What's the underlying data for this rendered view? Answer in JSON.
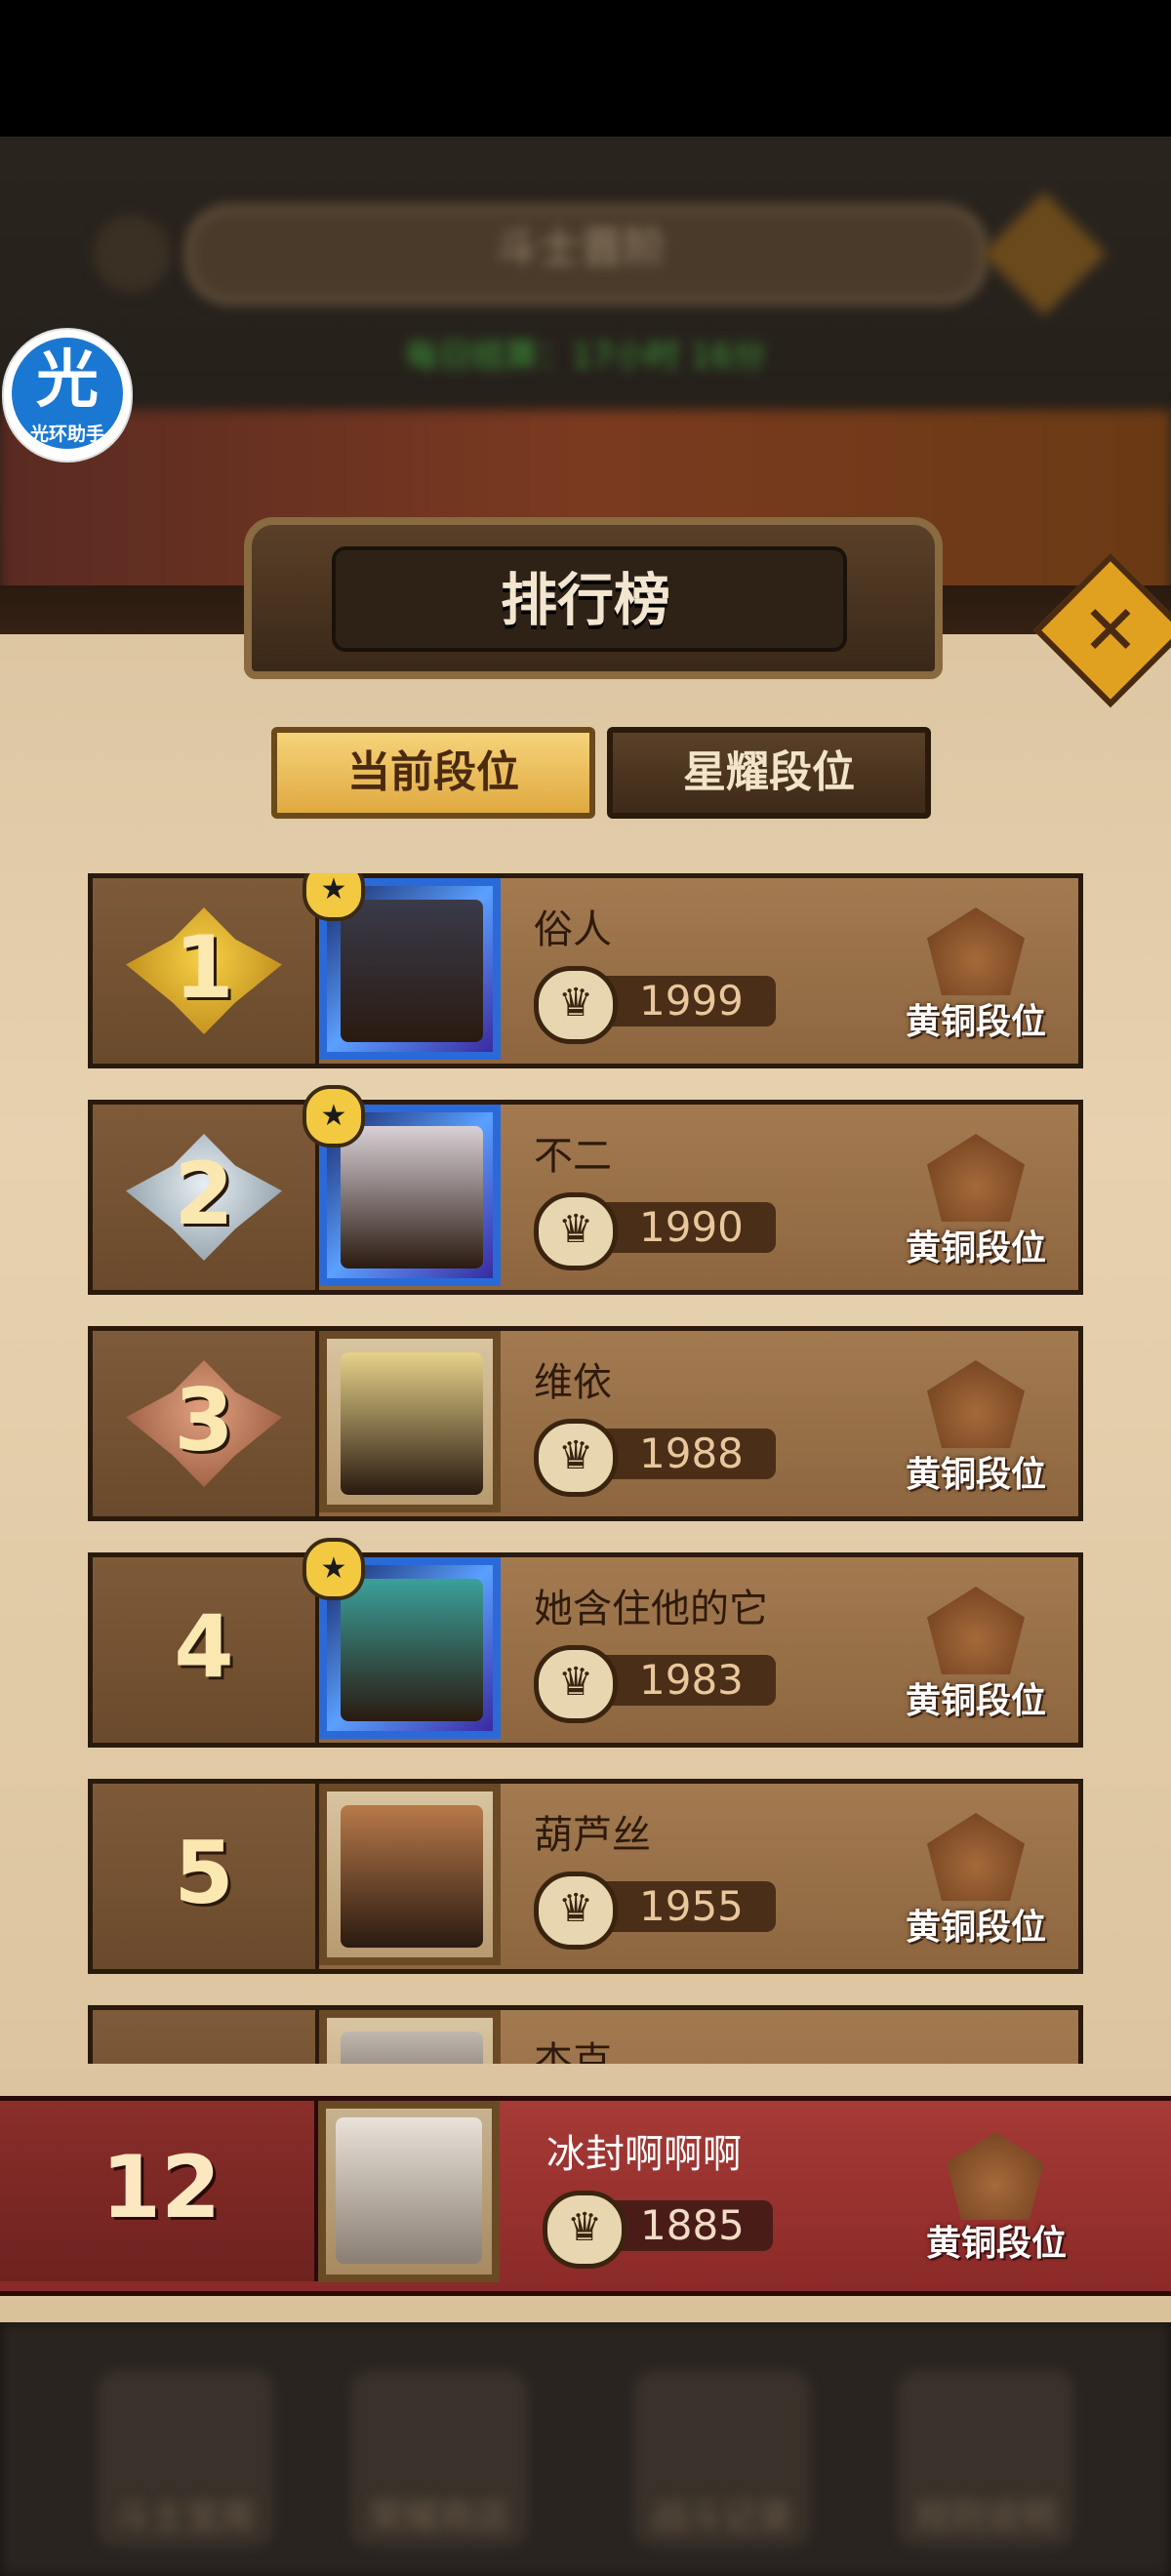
{
  "background": {
    "title": "斗士晋阶",
    "status": "每日结算：17小时 16分",
    "nav": [
      "斗士宝库",
      "荣耀商店",
      "战斗记录",
      "规则说明"
    ]
  },
  "helper_badge": {
    "char": "光",
    "label": "光环助手"
  },
  "header": {
    "title": "排行榜",
    "close_icon": "close-x-icon"
  },
  "tabs": [
    {
      "label": "当前段位",
      "active": true
    },
    {
      "label": "星耀段位",
      "active": false
    }
  ],
  "leaderboard": [
    {
      "rank": "1",
      "medal": "gold",
      "name": "俗人",
      "score": "1999",
      "tier": "黄铜段位",
      "frame": "holo"
    },
    {
      "rank": "2",
      "medal": "silver",
      "name": "不二",
      "score": "1990",
      "tier": "黄铜段位",
      "frame": "holo"
    },
    {
      "rank": "3",
      "medal": "bronze",
      "name": "维依",
      "score": "1988",
      "tier": "黄铜段位",
      "frame": "plain"
    },
    {
      "rank": "4",
      "medal": "",
      "name": "她含住他的它",
      "score": "1983",
      "tier": "黄铜段位",
      "frame": "holo"
    },
    {
      "rank": "5",
      "medal": "",
      "name": "葫芦丝",
      "score": "1955",
      "tier": "黄铜段位",
      "frame": "plain"
    },
    {
      "rank": "",
      "medal": "",
      "name": "杰克",
      "score": "",
      "tier": "",
      "frame": "plain"
    }
  ],
  "self": {
    "rank": "12",
    "name": "冰封啊啊啊",
    "score": "1885",
    "tier": "黄铜段位"
  },
  "colors": {
    "accent_gold": "#f6d37a",
    "panel": "#ddc6a2",
    "self_row": "#a63a36"
  }
}
